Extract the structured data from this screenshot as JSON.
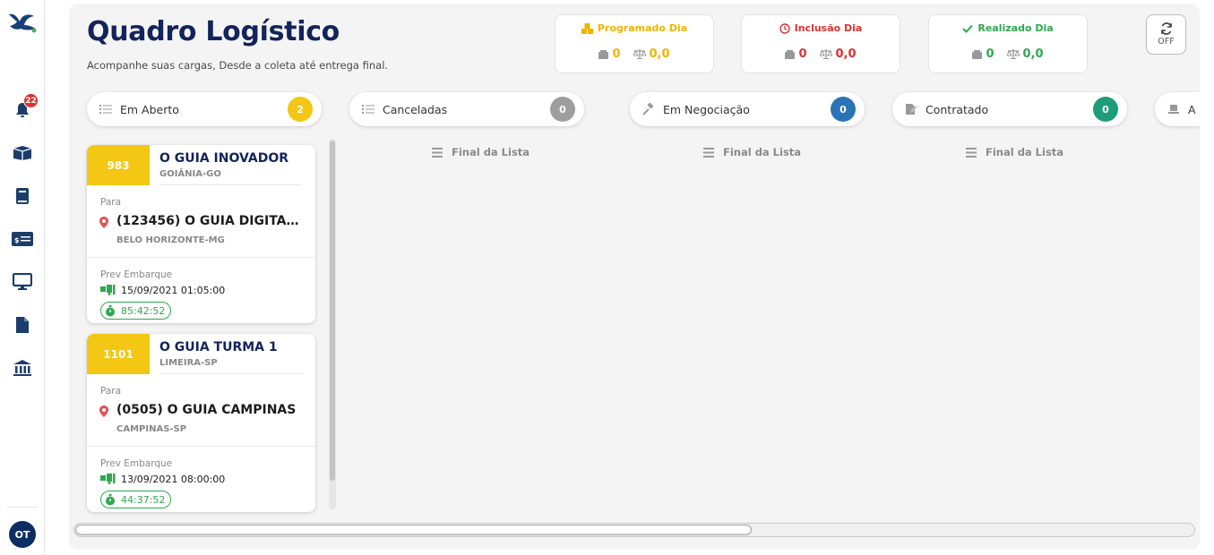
{
  "sidebar": {
    "notifications_count": "22",
    "avatar_initials": "OT"
  },
  "header": {
    "title": "Quadro Logístico",
    "subtitle": "Acompanhe suas cargas, Desde a coleta até entrega final."
  },
  "stats": [
    {
      "title": "Programado Dia",
      "boxes": "0",
      "weight": "0,0",
      "color": "#f0b400"
    },
    {
      "title": "Inclusão Dia",
      "boxes": "0",
      "weight": "0,0",
      "color": "#e03131"
    },
    {
      "title": "Realizado Dia",
      "boxes": "0",
      "weight": "0,0",
      "color": "#2fa84f"
    }
  ],
  "refresh": {
    "label": "OFF"
  },
  "status_tabs": [
    {
      "label": "Em Aberto",
      "count": "2",
      "color": "#f3c713"
    },
    {
      "label": "Canceladas",
      "count": "0",
      "color": "#9e9e9e"
    },
    {
      "label": "Em Negociação",
      "count": "0",
      "color": "#2a73b7"
    },
    {
      "label": "Contratado",
      "count": "0",
      "color": "#1e9c7a"
    },
    {
      "label": "A"
    }
  ],
  "end_of_list": "Final da Lista",
  "cards": [
    {
      "number": "983",
      "origin_name": "O GUIA INOVADOR",
      "origin_city": "GOIÂNIA-GO",
      "to_label": "Para",
      "dest_name": "(123456) O GUIA DIGITAL ...",
      "dest_city": "BELO HORIZONTE-MG",
      "prev_label": "Prev Embarque",
      "date": "15/09/2021 01:05:00",
      "timer": "85:42:52"
    },
    {
      "number": "1101",
      "origin_name": "O GUIA TURMA 1",
      "origin_city": "LIMEIRA-SP",
      "to_label": "Para",
      "dest_name": "(0505) O GUIA CAMPINAS",
      "dest_city": "CAMPINAS-SP",
      "prev_label": "Prev Embarque",
      "date": "13/09/2021 08:00:00",
      "timer": "44:37:52"
    }
  ],
  "colors": {
    "navy": "#13235b",
    "yellow": "#f3c713",
    "green": "#2fa84f",
    "red": "#e03131"
  }
}
